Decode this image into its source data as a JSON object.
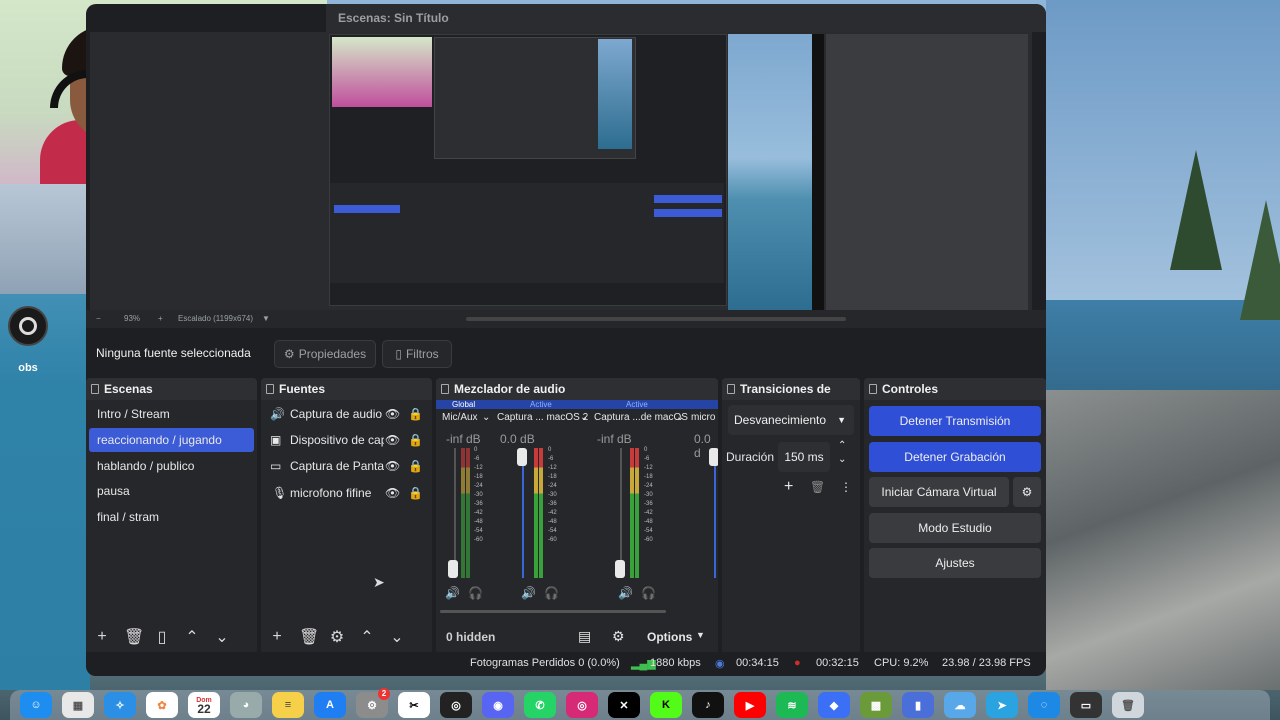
{
  "window": {
    "title": "Escenas: Sin Título"
  },
  "desktop": {
    "obs_label": "obs"
  },
  "preview": {
    "zoom": "93%",
    "scale": "Escalado (1199x674)"
  },
  "context": {
    "no_source": "Ninguna fuente seleccionada",
    "properties": "Propiedades",
    "filters": "Filtros"
  },
  "scenes": {
    "title": "Escenas",
    "items": [
      "Intro / Stream",
      "reaccionando / jugando",
      "hablando / publico",
      "pausa",
      "final / stram"
    ],
    "selected": 1
  },
  "sources": {
    "title": "Fuentes",
    "items": [
      "Captura de audio",
      "Dispositivo de cap",
      "Captura de Pantal",
      "microfono fifine"
    ]
  },
  "mixer": {
    "title": "Mezclador de audio",
    "global_tag": "Global",
    "active_tag": "Active",
    "channels": [
      {
        "name": "Mic/Aux",
        "db": "-inf dB"
      },
      {
        "name": "Captura ... macOS 2",
        "db": "0.0 dB"
      },
      {
        "name": "Captura ...de macOS",
        "db": "-inf dB"
      },
      {
        "name": "micro",
        "db": "0.0 d"
      }
    ],
    "scale": [
      "0",
      "-6",
      "-12",
      "-18",
      "-24",
      "-30",
      "-36",
      "-42",
      "-48",
      "-54",
      "-60"
    ],
    "hidden": "0 hidden",
    "options": "Options"
  },
  "transitions": {
    "title": "Transiciones de esc...",
    "type": "Desvanecimiento",
    "duration_label": "Duración",
    "duration": "150 ms"
  },
  "controls": {
    "title": "Controles",
    "stop_stream": "Detener Transmisión",
    "stop_record": "Detener Grabación",
    "virtual_cam": "Iniciar Cámara Virtual",
    "studio": "Modo Estudio",
    "settings": "Ajustes"
  },
  "status": {
    "dropped": "Fotogramas Perdidos 0 (0.0%)",
    "kbps": "1880 kbps",
    "stream_time": "00:34:15",
    "rec_time": "00:32:15",
    "cpu": "CPU: 9.2%",
    "fps": "23.98 / 23.98 FPS"
  },
  "dock": {
    "calendar_month": "Dom",
    "calendar_day": "22",
    "badge": "2"
  },
  "colors": {
    "accent": "#3c5bd6",
    "panel": "#26272b",
    "window": "#1e1f22"
  }
}
